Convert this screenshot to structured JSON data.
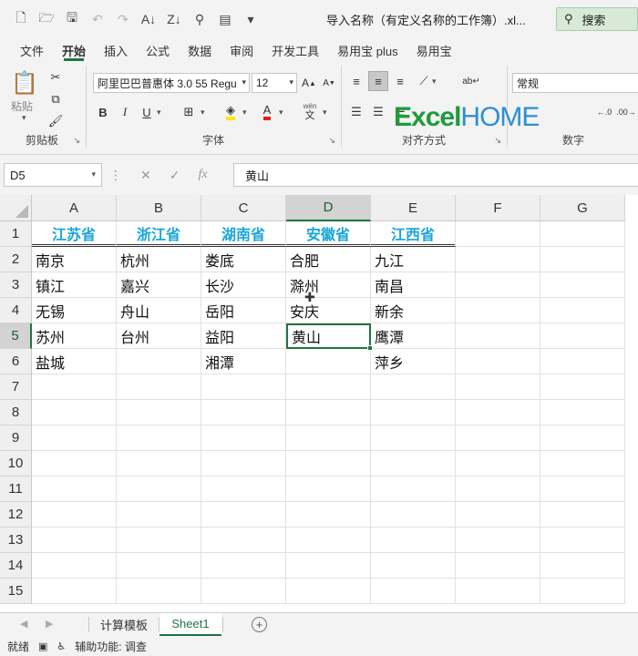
{
  "title": {
    "file": "导入名称（有定义名称的工作簿）.xl...",
    "search_label": "搜索"
  },
  "menu_tabs": [
    "文件",
    "开始",
    "插入",
    "公式",
    "数据",
    "审阅",
    "开发工具",
    "易用宝 plus",
    "易用宝"
  ],
  "ribbon": {
    "paste_label": "粘贴",
    "clipboard_label": "剪贴板",
    "font_name": "阿里巴巴普惠体 3.0 55 Regu",
    "font_size": "12",
    "font_label": "字体",
    "alignment_label": "对齐方式",
    "number_format": "常规",
    "number_label": "数字",
    "phonetic_top": "wén",
    "phonetic_bottom": "文",
    "logo_excel": "Excel",
    "logo_home": "HOME"
  },
  "formula_bar": {
    "name_box": "D5",
    "fx_label": "fx",
    "formula_value": "黄山"
  },
  "grid": {
    "columns": [
      "A",
      "B",
      "C",
      "D",
      "E",
      "F",
      "G"
    ],
    "rows": [
      "1",
      "2",
      "3",
      "4",
      "5",
      "6",
      "7",
      "8",
      "9",
      "10",
      "11",
      "12",
      "13",
      "14",
      "15"
    ],
    "header_row": [
      "江苏省",
      "浙江省",
      "湖南省",
      "安徽省",
      "江西省"
    ],
    "data": [
      [
        "南京",
        "杭州",
        "娄底",
        "合肥",
        "九江"
      ],
      [
        "镇江",
        "嘉兴",
        "长沙",
        "滁州",
        "南昌"
      ],
      [
        "无锡",
        "舟山",
        "岳阳",
        "安庆",
        "新余"
      ],
      [
        "苏州",
        "台州",
        "益阳",
        "黄山",
        "鹰潭"
      ],
      [
        "盐城",
        "",
        "湘潭",
        "",
        "萍乡"
      ]
    ],
    "active_cell": "D5"
  },
  "sheets": [
    "计算模板",
    "Sheet1"
  ],
  "active_sheet": "Sheet1",
  "status": {
    "ready": "就绪",
    "accessibility": "辅助功能: 调查"
  },
  "colors": {
    "accent": "#217346",
    "header_text": "#1aa5d8",
    "logo_excel": "#1f9a3c",
    "logo_home": "#2d8fd5"
  }
}
